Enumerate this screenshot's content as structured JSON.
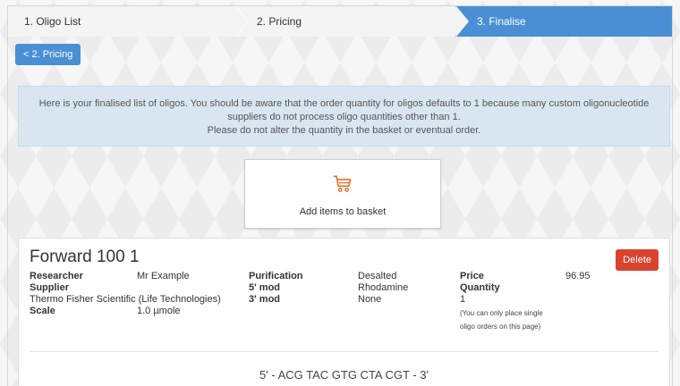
{
  "steps": [
    {
      "label": "1. Oligo List"
    },
    {
      "label": "2. Pricing"
    },
    {
      "label": "3. Finalise"
    }
  ],
  "back_button": {
    "label": "< 2. Pricing"
  },
  "notice": {
    "line1": "Here is your finalised list of oligos. You should be aware that the order quantity for oligos defaults to 1 because many custom oligonucleotide",
    "line2": "suppliers do not process oligo quantities other than 1.",
    "line3": "Please do not alter the quantity in the basket or eventual order."
  },
  "basket": {
    "label": "Add items to basket",
    "icon": "cart-icon"
  },
  "oligo": {
    "title": "Forward 100 1",
    "delete_label": "Delete",
    "researcher_label": "Researcher",
    "researcher_value": "Mr Example",
    "supplier_label": "Supplier",
    "supplier_value": "Thermo Fisher Scientific (Life Technologies)",
    "scale_label": "Scale",
    "scale_value": "1.0 µmole",
    "purification_label": "Purification",
    "purification_value": "Desalted",
    "mod5_label": "5' mod",
    "mod5_value": "Rhodamine",
    "mod3_label": "3' mod",
    "mod3_value": "None",
    "price_label": "Price",
    "price_value": "96.95",
    "quantity_label": "Quantity",
    "quantity_value": "1",
    "quantity_note_1": "(You can only place single",
    "quantity_note_2": "oligo orders on this page)",
    "sequence": "5' - ACG TAC GTG CTA CGT - 3'"
  },
  "colors": {
    "accent": "#4a8fd4",
    "danger": "#d9432f",
    "cart": "#e0702a",
    "notice_bg": "#d9e6f2"
  }
}
